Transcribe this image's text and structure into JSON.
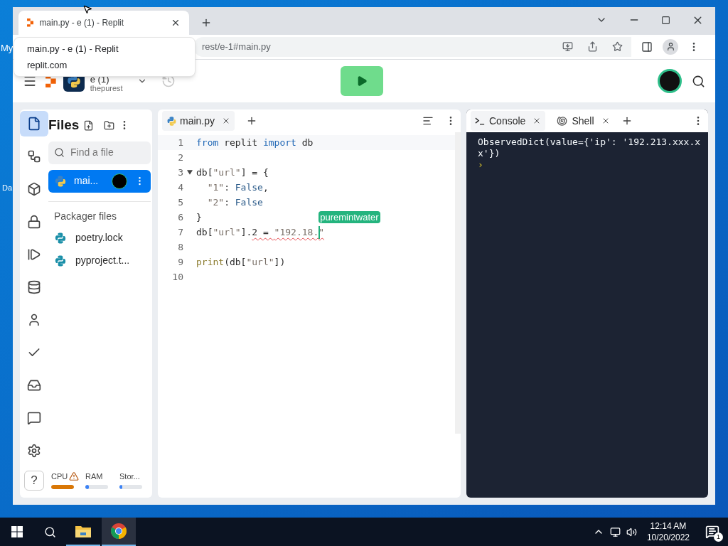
{
  "desktop": {
    "icon_labels": [
      "My",
      "Da"
    ]
  },
  "browser": {
    "tabs": [
      {
        "title": "main.py - e (1) - Replit",
        "selected": true
      }
    ],
    "tooltip": {
      "title": "main.py - e (1) - Replit",
      "subtitle": "replit.com"
    },
    "address": "rest/e-1#main.py"
  },
  "header": {
    "project": "e (1)",
    "owner": "thepurest"
  },
  "rail": {
    "items": [
      {
        "kind": "files",
        "selected": true
      },
      {
        "kind": "git",
        "selected": false
      },
      {
        "kind": "packages",
        "selected": false
      },
      {
        "kind": "secrets",
        "selected": false
      },
      {
        "kind": "debugger",
        "selected": false
      },
      {
        "kind": "database",
        "selected": false
      },
      {
        "kind": "user",
        "selected": false
      },
      {
        "kind": "check",
        "selected": false
      },
      {
        "kind": "inbox",
        "selected": false
      },
      {
        "kind": "chat",
        "selected": false
      },
      {
        "kind": "settings",
        "selected": false
      }
    ],
    "help": "?"
  },
  "files": {
    "title": "Files",
    "search_placeholder": "Find a file",
    "items": [
      {
        "name": "mai...",
        "selected": true
      }
    ],
    "section": "Packager files",
    "packager_items": [
      {
        "name": "poetry.lock"
      },
      {
        "name": "pyproject.t..."
      }
    ]
  },
  "resources": [
    {
      "label": "CPU",
      "warning": true,
      "level": 1,
      "color": "#d97706"
    },
    {
      "label": "RAM",
      "warning": false,
      "level": 0.15,
      "color": "#3b82f6"
    },
    {
      "label": "Stor...",
      "warning": false,
      "level": 0.05,
      "color": "#3b82f6"
    }
  ],
  "editor": {
    "tabs": [
      {
        "label": "main.py",
        "selected": true
      }
    ],
    "lines": [
      {
        "number": "1",
        "tokens": [
          {
            "text": "from",
            "kind": "keyword",
            "error": false
          },
          {
            "text": " replit ",
            "kind": "plain",
            "error": false
          },
          {
            "text": "import",
            "kind": "keyword",
            "error": false
          },
          {
            "text": " db",
            "kind": "plain",
            "error": false
          }
        ]
      },
      {
        "number": "2"
      },
      {
        "number": "3",
        "fold_expanded": true,
        "tokens": [
          {
            "text": "db[",
            "kind": "plain",
            "error": false
          },
          {
            "text": "\"url\"",
            "kind": "string",
            "error": false
          },
          {
            "text": "] = {",
            "kind": "plain",
            "error": false
          }
        ]
      },
      {
        "number": "4",
        "tokens": [
          {
            "text": "  \"1\"",
            "kind": "string",
            "error": false
          },
          {
            "text": ": ",
            "kind": "plain",
            "error": false
          },
          {
            "text": "False",
            "kind": "constant",
            "error": false
          },
          {
            "text": ",",
            "kind": "plain",
            "error": false
          }
        ]
      },
      {
        "number": "5",
        "tokens": [
          {
            "text": "  \"2\"",
            "kind": "string",
            "error": false
          },
          {
            "text": ": ",
            "kind": "plain",
            "error": false
          },
          {
            "text": "False",
            "kind": "constant",
            "error": false
          }
        ]
      },
      {
        "number": "6",
        "tokens": [
          {
            "text": "}",
            "kind": "plain",
            "error": false
          }
        ]
      },
      {
        "number": "7",
        "tokens": [
          {
            "text": "db[",
            "kind": "plain",
            "error": false
          },
          {
            "text": "\"url\"",
            "kind": "string",
            "error": false
          },
          {
            "text": "].",
            "kind": "plain",
            "error": false
          },
          {
            "text": "2 = ",
            "kind": "plain",
            "error": true
          },
          {
            "text": "\"192.18.",
            "kind": "string",
            "error": true
          },
          {
            "kind": "cursor",
            "label": "puremintwater"
          },
          {
            "text": "\"",
            "kind": "string",
            "error": true
          }
        ]
      },
      {
        "number": "8"
      },
      {
        "number": "9",
        "tokens": [
          {
            "text": "print",
            "kind": "function",
            "error": false
          },
          {
            "text": "(db[",
            "kind": "plain",
            "error": false
          },
          {
            "text": "\"url\"",
            "kind": "string",
            "error": false
          },
          {
            "text": "])",
            "kind": "plain",
            "error": false
          }
        ]
      },
      {
        "number": "10"
      }
    ]
  },
  "console": {
    "tabs": [
      {
        "label": "Console",
        "kind": "console",
        "selected": true
      },
      {
        "label": "Shell",
        "kind": "shell",
        "selected": false
      }
    ],
    "output": "ObservedDict(value={'ip': '192.213.xxx.xx'})",
    "prompt": "›"
  },
  "taskbar": {
    "apps": [
      {
        "kind": "explorer",
        "selected": false
      },
      {
        "kind": "chrome",
        "selected": true
      }
    ],
    "time": "12:14 AM",
    "date": "10/20/2022",
    "notifications": "1"
  }
}
